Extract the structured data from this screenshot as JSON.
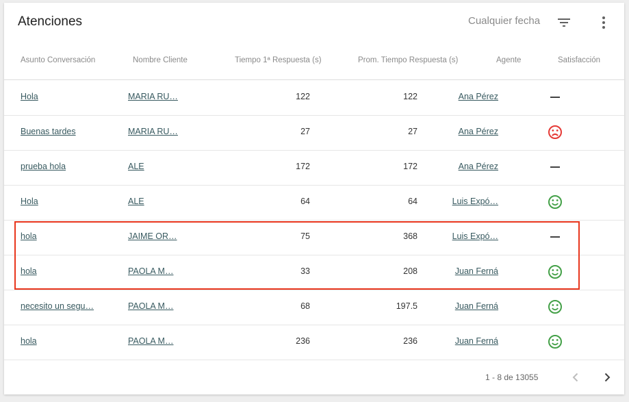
{
  "card": {
    "title": "Atenciones",
    "date_filter": "Cualquier fecha",
    "filter_icon": "filter-list-icon",
    "more_icon": "more-vert-icon"
  },
  "columns": {
    "subject": "Asunto Conversación",
    "client": "Nombre Cliente",
    "first_response": "Tiempo 1ª Respuesta (s)",
    "avg_response": "Prom. Tiempo Respuesta (s)",
    "agent": "Agente",
    "satisfaction": "Satisfacción"
  },
  "rows": [
    {
      "subject": "Hola",
      "client": "MARIA RU…",
      "first_response": "122",
      "avg_response": "122",
      "agent": "Ana Pérez",
      "satisfaction": "neutral"
    },
    {
      "subject": "Buenas tardes",
      "client": "MARIA RU…",
      "first_response": "27",
      "avg_response": "27",
      "agent": "Ana Pérez",
      "satisfaction": "sad"
    },
    {
      "subject": "prueba hola",
      "client": "ALE",
      "first_response": "172",
      "avg_response": "172",
      "agent": "Ana Pérez",
      "satisfaction": "neutral"
    },
    {
      "subject": "Hola",
      "client": "ALE",
      "first_response": "64",
      "avg_response": "64",
      "agent": "Luis Expó…",
      "satisfaction": "happy"
    },
    {
      "subject": "hola",
      "client": "JAIME OR…",
      "first_response": "75",
      "avg_response": "368",
      "agent": "Luis Expó…",
      "satisfaction": "neutral"
    },
    {
      "subject": "hola",
      "client": "PAOLA M…",
      "first_response": "33",
      "avg_response": "208",
      "agent": "Juan Ferná",
      "satisfaction": "happy"
    },
    {
      "subject": "necesito un segu…",
      "client": "PAOLA M…",
      "first_response": "68",
      "avg_response": "197.5",
      "agent": "Juan Ferná",
      "satisfaction": "happy"
    },
    {
      "subject": "hola",
      "client": "PAOLA M…",
      "first_response": "236",
      "avg_response": "236",
      "agent": "Juan Ferná",
      "satisfaction": "happy"
    }
  ],
  "pagination": {
    "range": "1 - 8 de 13055",
    "prev_icon": "chevron-left-icon",
    "next_icon": "chevron-right-icon"
  },
  "colors": {
    "sad": "#e53935",
    "happy": "#43a047",
    "neutral": "#424242",
    "highlight": "#e8351c",
    "link": "#37595f"
  }
}
